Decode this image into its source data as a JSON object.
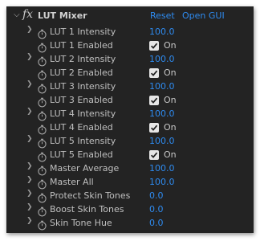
{
  "effect": {
    "title": "LUT Mixer",
    "fx_symbol": "fx",
    "reset_label": "Reset",
    "open_gui_label": "Open GUI"
  },
  "colors": {
    "panel_bg": "#232323",
    "value_blue": "#2e8bf0",
    "label_gray": "#c0c0c0"
  },
  "properties": [
    {
      "label": "LUT 1 Intensity",
      "type": "slider",
      "value": "100.0",
      "expandable": true
    },
    {
      "label": "LUT 1 Enabled",
      "type": "checkbox",
      "checkbox_label": "On",
      "checked": true,
      "expandable": false
    },
    {
      "label": "LUT 2 Intensity",
      "type": "slider",
      "value": "100.0",
      "expandable": true
    },
    {
      "label": "LUT 2 Enabled",
      "type": "checkbox",
      "checkbox_label": "On",
      "checked": true,
      "expandable": false
    },
    {
      "label": "LUT 3 Intensity",
      "type": "slider",
      "value": "100.0",
      "expandable": true
    },
    {
      "label": "LUT 3 Enabled",
      "type": "checkbox",
      "checkbox_label": "On",
      "checked": true,
      "expandable": false
    },
    {
      "label": "LUT 4 Intensity",
      "type": "slider",
      "value": "100.0",
      "expandable": true
    },
    {
      "label": "LUT 4 Enabled",
      "type": "checkbox",
      "checkbox_label": "On",
      "checked": true,
      "expandable": false
    },
    {
      "label": "LUT 5 Intensity",
      "type": "slider",
      "value": "100.0",
      "expandable": true
    },
    {
      "label": "LUT 5 Enabled",
      "type": "checkbox",
      "checkbox_label": "On",
      "checked": true,
      "expandable": false
    },
    {
      "label": "Master Average",
      "type": "slider",
      "value": "100.0",
      "expandable": true
    },
    {
      "label": "Master All",
      "type": "slider",
      "value": "100.0",
      "expandable": true
    },
    {
      "label": "Protect Skin Tones",
      "type": "slider",
      "value": "0.0",
      "expandable": true
    },
    {
      "label": "Boost Skin Tones",
      "type": "slider",
      "value": "0.0",
      "expandable": true
    },
    {
      "label": "Skin Tone Hue",
      "type": "slider",
      "value": "0.0",
      "expandable": true
    }
  ],
  "icons": {
    "expand": "chevron-right-icon",
    "collapse": "chevron-down-icon",
    "keyframe": "stopwatch-icon",
    "check": "checkmark-icon"
  }
}
